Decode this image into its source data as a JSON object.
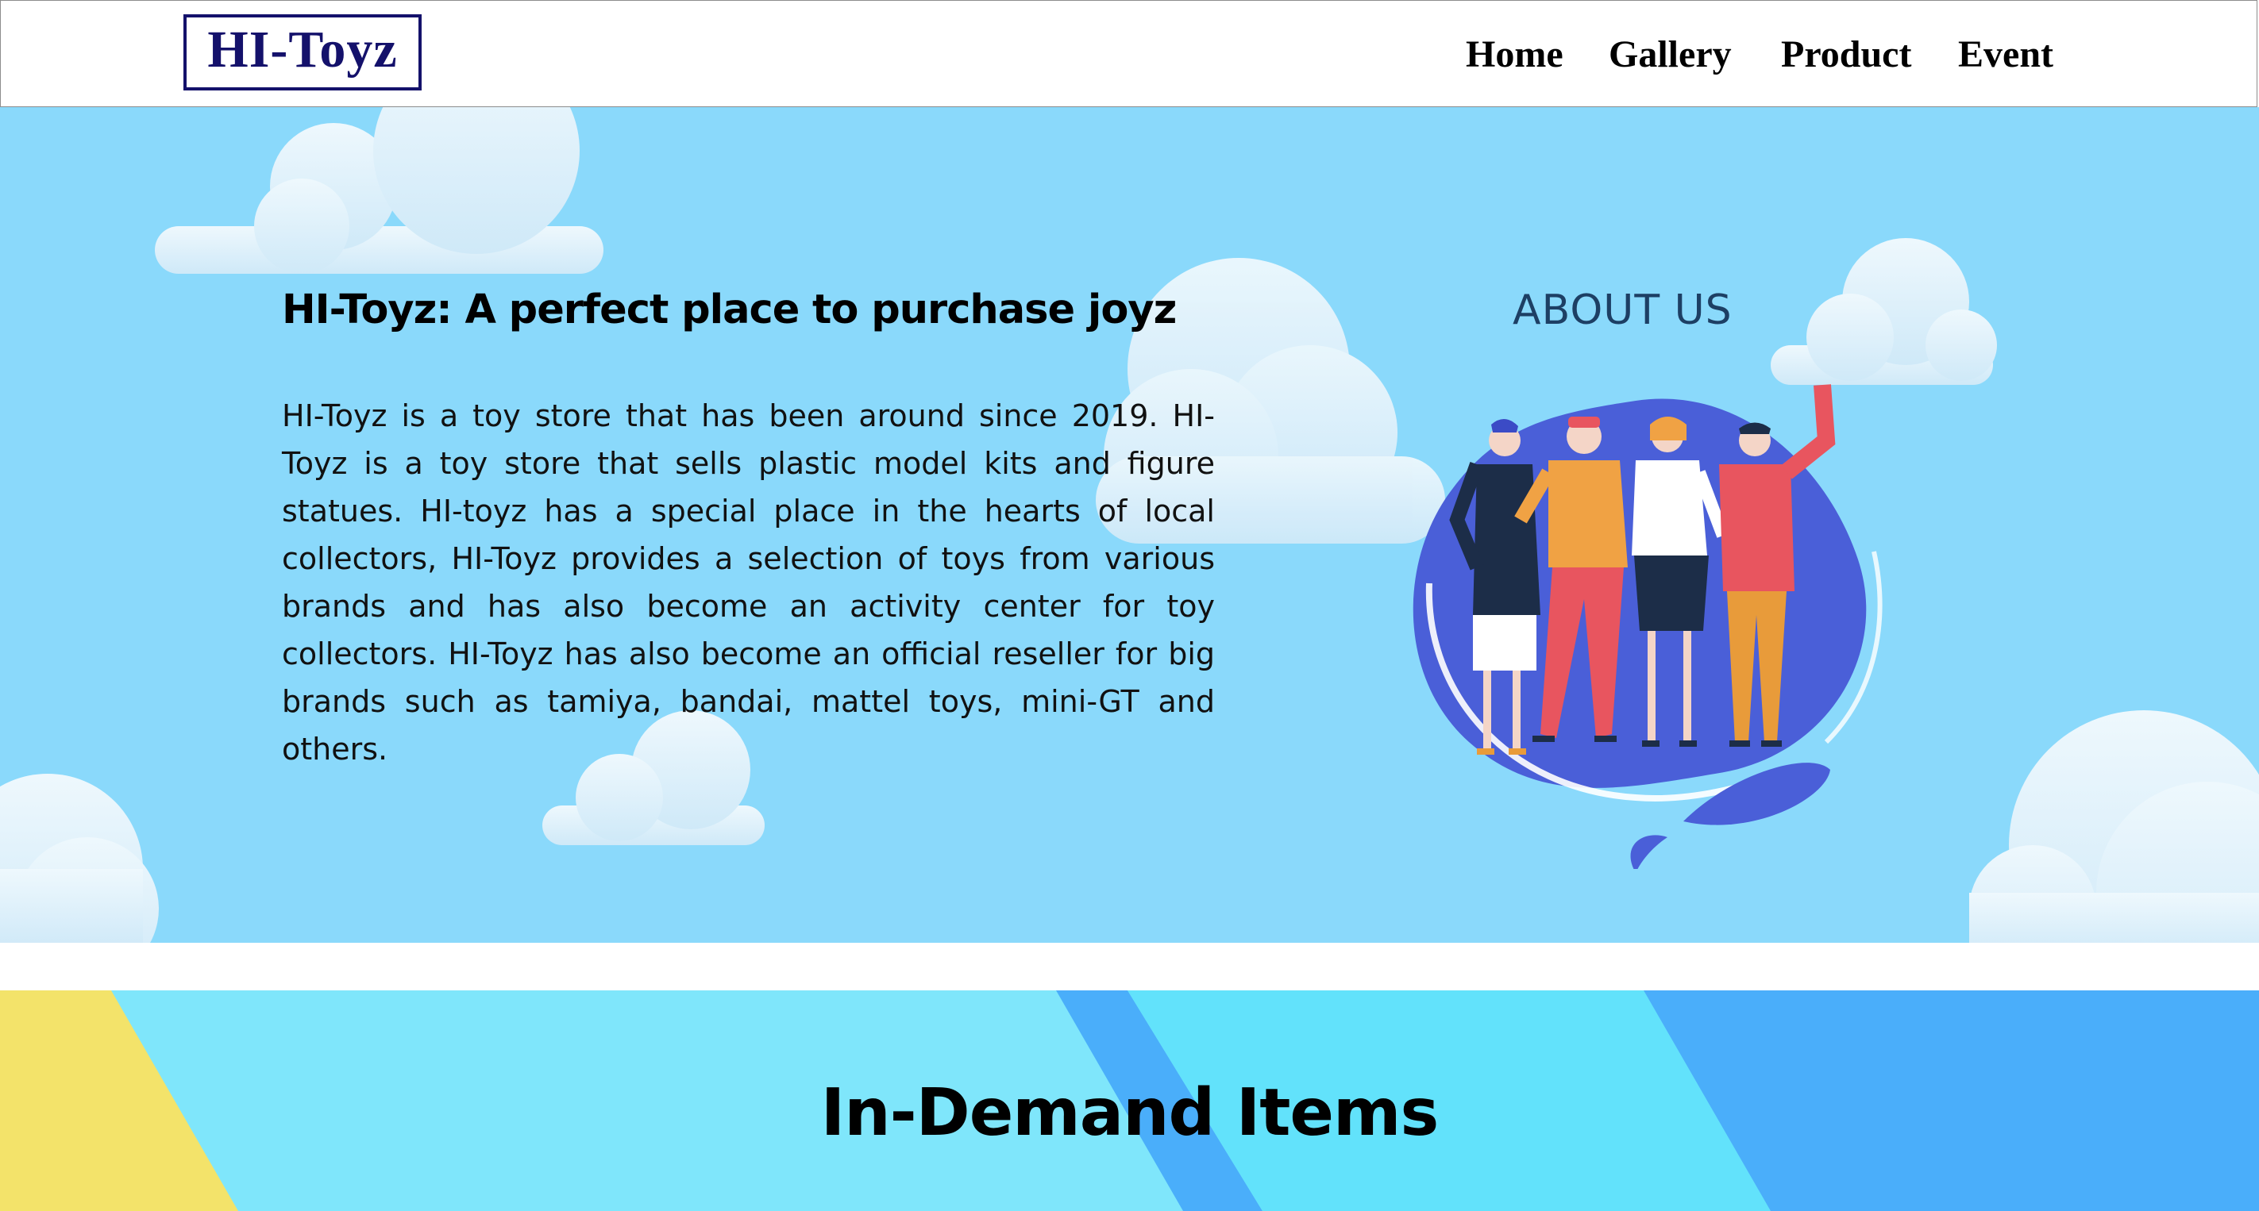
{
  "header": {
    "logo_text": "HI-Toyz",
    "nav": [
      {
        "label": "Home"
      },
      {
        "label": "Gallery"
      },
      {
        "label": "Product"
      },
      {
        "label": "Event"
      }
    ]
  },
  "about": {
    "title": "HI-Toyz: A perfect place to purchase joyz",
    "body": "HI-Toyz is a toy store that has been around since 2019. HI-Toyz is a toy store that sells plastic model kits and figure statues. HI-toyz has a special place in the hearts of local collectors, HI-Toyz provides a selection of toys from various brands and has also become an activity center for toy collectors. HI-Toyz has also become an official reseller for big brands such as tamiya, bandai, mattel toys, mini-GT and others.",
    "image_label": "ABOUT US"
  },
  "in_demand": {
    "title": "In-Demand Items"
  },
  "colors": {
    "logo_navy": "#14116b",
    "sky_background": "#8ad9fb",
    "cloud": "#e6f4fc",
    "blob_blue": "#4a5fd8",
    "demand_cyan": "#7fe6fb",
    "demand_blue": "#4aaefa",
    "demand_yellow": "#f3e36a"
  }
}
